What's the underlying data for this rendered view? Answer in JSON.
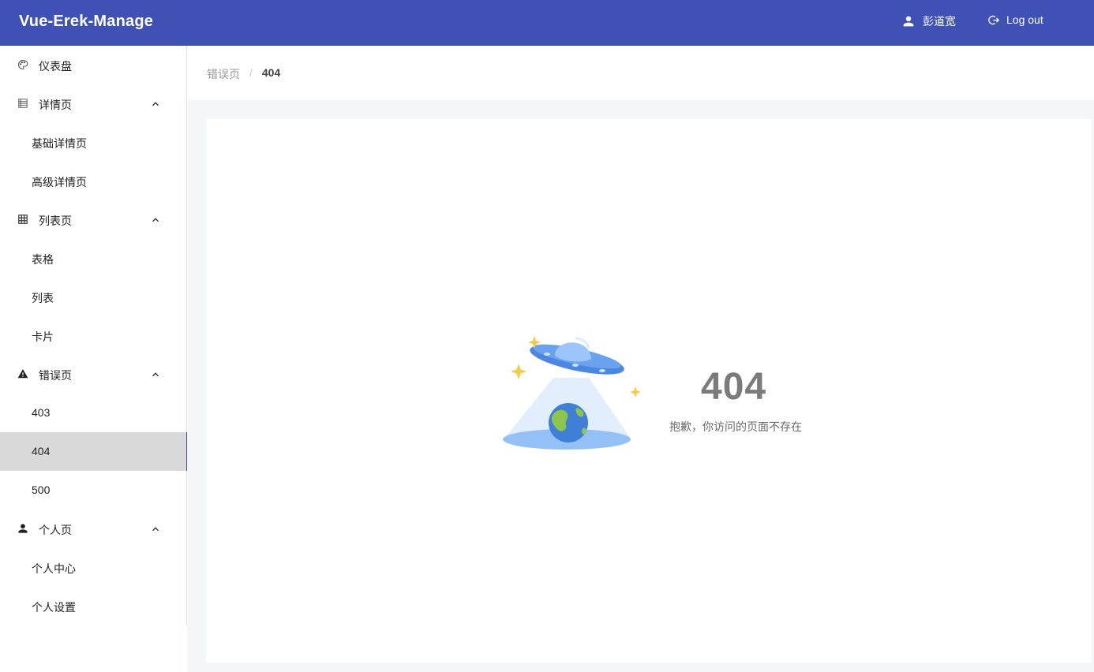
{
  "app": {
    "title": "Vue-Erek-Manage"
  },
  "header": {
    "user_name": "彭道宽",
    "logout_label": "Log out"
  },
  "sidebar": {
    "items": [
      {
        "label": "仪表盘",
        "level": "top",
        "icon": "palette-icon"
      },
      {
        "label": "详情页",
        "level": "top",
        "icon": "list-detail-icon",
        "expanded": true
      },
      {
        "label": "基础详情页",
        "level": "sub"
      },
      {
        "label": "高级详情页",
        "level": "sub"
      },
      {
        "label": "列表页",
        "level": "top",
        "icon": "grid-icon",
        "expanded": true
      },
      {
        "label": "表格",
        "level": "sub"
      },
      {
        "label": "列表",
        "level": "sub"
      },
      {
        "label": "卡片",
        "level": "sub"
      },
      {
        "label": "错误页",
        "level": "top",
        "icon": "warning-icon",
        "expanded": true
      },
      {
        "label": "403",
        "level": "sub"
      },
      {
        "label": "404",
        "level": "sub",
        "active": true
      },
      {
        "label": "500",
        "level": "sub"
      },
      {
        "label": "个人页",
        "level": "top",
        "icon": "person-icon",
        "expanded": true
      },
      {
        "label": "个人中心",
        "level": "sub"
      },
      {
        "label": "个人设置",
        "level": "sub"
      }
    ]
  },
  "breadcrumb": {
    "parent": "错误页",
    "separator": "/",
    "current": "404"
  },
  "error": {
    "code": "404",
    "message": "抱歉，你访问的页面不存在"
  },
  "colors": {
    "accent": "#3f51b5",
    "active_bg": "#d9d9d9"
  }
}
